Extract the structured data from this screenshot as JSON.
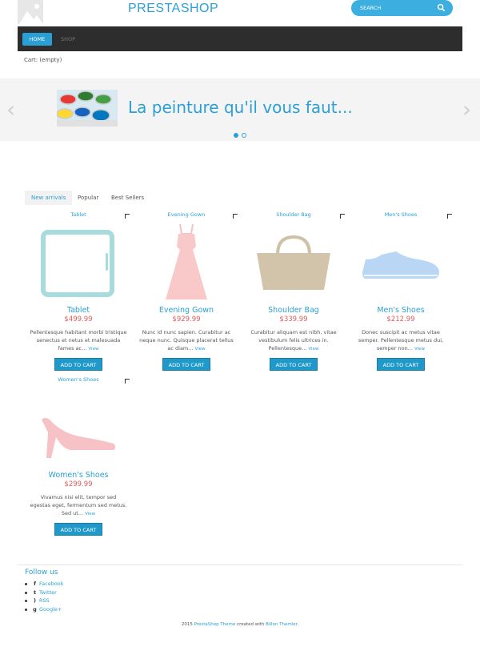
{
  "header": {
    "brand": "PRESTASHOP",
    "search_placeholder": "SEARCH"
  },
  "nav": {
    "home": "HOME",
    "shop": "SHOP"
  },
  "cart": "Cart: (empty)",
  "slider": {
    "title": "La peinture qu'il vous faut..."
  },
  "tabs": [
    {
      "label": "New arrivals",
      "active": true
    },
    {
      "label": "Popular",
      "active": false
    },
    {
      "label": "Best Sellers",
      "active": false
    }
  ],
  "products": [
    {
      "top_label": "Tablet",
      "name": "Tablet",
      "price": "$499.99",
      "desc": "Pellentesque habitant morbi tristique senectus et netus et malesuada fames ac...",
      "view": "View",
      "button": "ADD TO CART",
      "icon": "tablet-icon"
    },
    {
      "top_label": "Evening Gown",
      "name": "Evening Gown",
      "price": "$929.99",
      "desc": "Nunc id nunc sapien. Curabitur ac neque nunc. Quisque placerat tellus ac diam...",
      "view": "View",
      "button": "ADD TO CART",
      "icon": "dress-icon"
    },
    {
      "top_label": "Shoulder Bag",
      "name": "Shoulder Bag",
      "price": "$339.99",
      "desc": "Curabitur aliquam est nibh, vitae vestibulum felis ultrices in. Pellentesque...",
      "view": "View",
      "button": "ADD TO CART",
      "icon": "bag-icon"
    },
    {
      "top_label": "Men's Shoes",
      "name": "Men's Shoes",
      "price": "$212.99",
      "desc": "Donec suscipit ac metus vitae semper. Pellentesque metus dui, semper non...",
      "view": "View",
      "button": "ADD TO CART",
      "icon": "mens-shoe-icon"
    },
    {
      "top_label": "Women's Shoes",
      "name": "Women's Shoes",
      "price": "$299.99",
      "desc": "Vivamus nisi elit, tempor sed egestas eget, fermentum sed metus. Sed ut...",
      "view": "View",
      "button": "ADD TO CART",
      "icon": "heel-icon"
    }
  ],
  "footer": {
    "follow_title": "Follow us",
    "social": [
      {
        "label": "Facebook",
        "icon": "facebook-icon"
      },
      {
        "label": "Twitter",
        "icon": "twitter-icon"
      },
      {
        "label": "RSS",
        "icon": "rss-icon"
      },
      {
        "label": "Google+",
        "icon": "google-plus-icon"
      }
    ],
    "copyright_prefix": "2015",
    "copyright_link1": "PrestaShop Theme",
    "copyright_mid": "created with",
    "copyright_link2": "Billon Themler",
    "copyright_suffix": "."
  },
  "colors": {
    "accent": "#2aa0d4",
    "button": "#1f99c9",
    "price": "#e05a5a",
    "nav_bg": "#2d2d2d"
  }
}
